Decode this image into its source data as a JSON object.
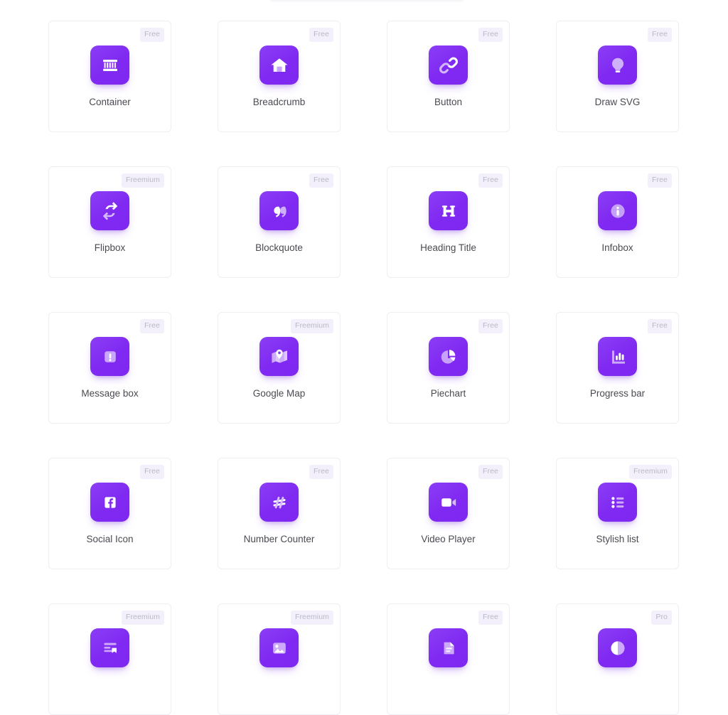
{
  "page": {
    "background_color": "#ffffff",
    "card_border_color": "#eeeef3",
    "icon_tile_color": "#7f28f1",
    "badge_background": "#f3f0fb",
    "badge_text_color": "#b9b9c6",
    "label_text_color": "#4a4a52"
  },
  "widgets": [
    {
      "label": "Container",
      "badge": "Free",
      "icon": "container-icon"
    },
    {
      "label": "Breadcrumb",
      "badge": "Free",
      "icon": "home-icon"
    },
    {
      "label": "Button",
      "badge": "Free",
      "icon": "link-chain-icon"
    },
    {
      "label": "Draw SVG",
      "badge": "Free",
      "icon": "lightbulb-icon"
    },
    {
      "label": "Flipbox",
      "badge": "Freemium",
      "icon": "flip-arrows-icon"
    },
    {
      "label": "Blockquote",
      "badge": "Free",
      "icon": "quote-marks-icon"
    },
    {
      "label": "Heading Title",
      "badge": "Free",
      "icon": "letter-h-icon"
    },
    {
      "label": "Infobox",
      "badge": "Free",
      "icon": "info-circle-icon"
    },
    {
      "label": "Message box",
      "badge": "Free",
      "icon": "exclamation-box-icon"
    },
    {
      "label": "Google Map",
      "badge": "Freemium",
      "icon": "map-pin-icon"
    },
    {
      "label": "Piechart",
      "badge": "Free",
      "icon": "pie-chart-icon"
    },
    {
      "label": "Progress bar",
      "badge": "Free",
      "icon": "bar-chart-icon"
    },
    {
      "label": "Social Icon",
      "badge": "Free",
      "icon": "facebook-icon"
    },
    {
      "label": "Number Counter",
      "badge": "Free",
      "icon": "hashtag-icon"
    },
    {
      "label": "Video Player",
      "badge": "Free",
      "icon": "video-camera-icon"
    },
    {
      "label": "Stylish list",
      "badge": "Freemium",
      "icon": "bullet-list-icon"
    },
    {
      "label": "",
      "badge": "Freemium",
      "icon": "text-block-icon"
    },
    {
      "label": "",
      "badge": "Freemium",
      "icon": "image-card-icon"
    },
    {
      "label": "",
      "badge": "Free",
      "icon": "document-page-icon"
    },
    {
      "label": "",
      "badge": "Pro",
      "icon": "half-circle-icon"
    }
  ]
}
